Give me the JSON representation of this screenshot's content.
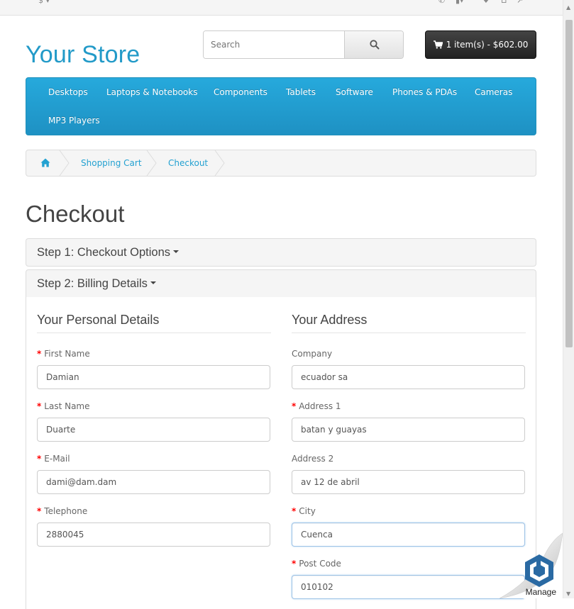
{
  "header": {
    "logo_text": "Your Store",
    "search": {
      "placeholder": "Search"
    },
    "cart": {
      "label": "1 item(s) - $602.00"
    }
  },
  "menu": {
    "items": [
      "Desktops",
      "Laptops & Notebooks",
      "Components",
      "Tablets",
      "Software",
      "Phones & PDAs",
      "Cameras",
      "MP3 Players"
    ]
  },
  "breadcrumb": {
    "items": [
      "Shopping Cart",
      "Checkout"
    ]
  },
  "page": {
    "title": "Checkout",
    "step1": "Step 1: Checkout Options",
    "step2": "Step 2: Billing Details"
  },
  "personal": {
    "legend": "Your Personal Details",
    "fields": [
      {
        "label": "First Name",
        "value": "Damian",
        "required": true
      },
      {
        "label": "Last Name",
        "value": "Duarte",
        "required": true
      },
      {
        "label": "E-Mail",
        "value": "dami@dam.dam",
        "required": true
      },
      {
        "label": "Telephone",
        "value": "2880045",
        "required": true
      }
    ]
  },
  "address": {
    "legend": "Your Address",
    "fields": [
      {
        "label": "Company",
        "value": "ecuador sa",
        "required": false
      },
      {
        "label": "Address 1",
        "value": "batan y guayas",
        "required": true
      },
      {
        "label": "Address 2",
        "value": "av 12 de abril",
        "required": false
      },
      {
        "label": "City",
        "value": "Cuenca",
        "required": true
      },
      {
        "label": "Post Code",
        "value": "010102",
        "required": true
      }
    ]
  },
  "widget": {
    "label": "Manage"
  },
  "colors": {
    "accent": "#229ac8",
    "menu": "#229ac8",
    "required": "#ff0000"
  }
}
